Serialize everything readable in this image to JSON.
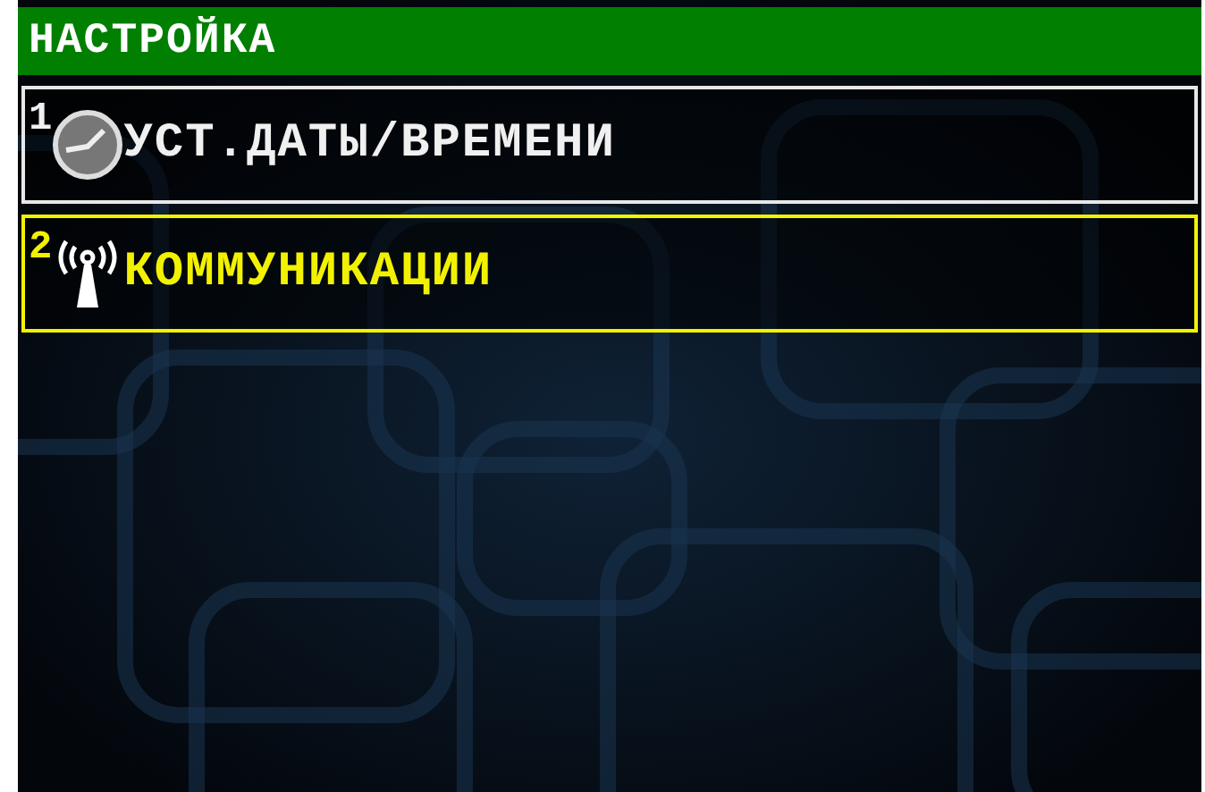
{
  "header": {
    "title": "НАСТРОЙКА"
  },
  "menu_items": [
    {
      "number": "1",
      "kind": "clock",
      "label": "УСТ.ДАТЫ/ВРЕМЕНИ",
      "selected": false
    },
    {
      "number": "2",
      "kind": "antenna",
      "label": "КОММУНИКАЦИИ",
      "selected": true
    }
  ]
}
